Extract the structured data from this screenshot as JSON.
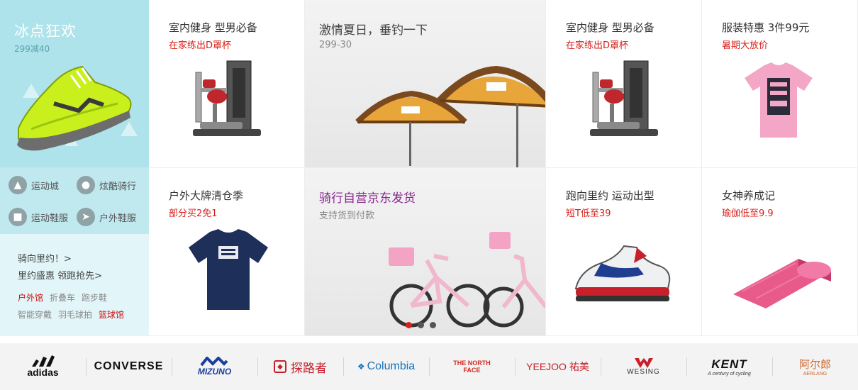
{
  "promo": {
    "title": "冰点狂欢",
    "subtitle": "299减40"
  },
  "categories": [
    {
      "label": "运动城",
      "icon": "shoe-icon"
    },
    {
      "label": "炫酷骑行",
      "icon": "bike-icon"
    },
    {
      "label": "运动鞋服",
      "icon": "shirt-icon"
    },
    {
      "label": "户外鞋服",
      "icon": "runner-icon"
    }
  ],
  "side_links": {
    "link1": "骑向里约！>",
    "link2": "里约盛惠 领跑抢先>",
    "tags": [
      "户外馆",
      "折叠车",
      "跑步鞋",
      "智能穿戴",
      "羽毛球拍",
      "篮球馆"
    ]
  },
  "cells": [
    {
      "title": "室内健身 型男必备",
      "sub": "在家练出D罩杯",
      "image": "fitness-machine"
    },
    {
      "title": "激情夏日，垂钓一下",
      "sub": "299-30",
      "image": "umbrella"
    },
    {
      "title": "室内健身 型男必备",
      "sub": "在家练出D罩杯",
      "image": "fitness-machine"
    },
    {
      "title": "服装特惠 3件99元",
      "sub": "暑期大放价",
      "image": "pink-tshirt"
    },
    {
      "title": "户外大牌清仓季",
      "sub": "部分买2免1",
      "image": "navy-tshirt"
    },
    {
      "title": "骑行自营京东发货",
      "sub": "支持货到付款",
      "image": "bicycle"
    },
    {
      "title": "跑向里约 运动出型",
      "sub": "短T低至39",
      "image": "sneaker"
    },
    {
      "title": "女神养成记",
      "sub": "瑜伽低至9.9",
      "image": "yoga-mat"
    }
  ],
  "carousel": {
    "count": 3,
    "active": 0
  },
  "brands": [
    "adidas",
    "CONVERSE",
    "MIZUNO",
    "探路者",
    "Columbia",
    "THE NORTH FACE",
    "YEEJOO 祐美",
    "WESING",
    "KENT",
    "阿尔郎"
  ],
  "brand_subs": {
    "kent": "A century of cycling",
    "aerlang": "AERLANG"
  }
}
